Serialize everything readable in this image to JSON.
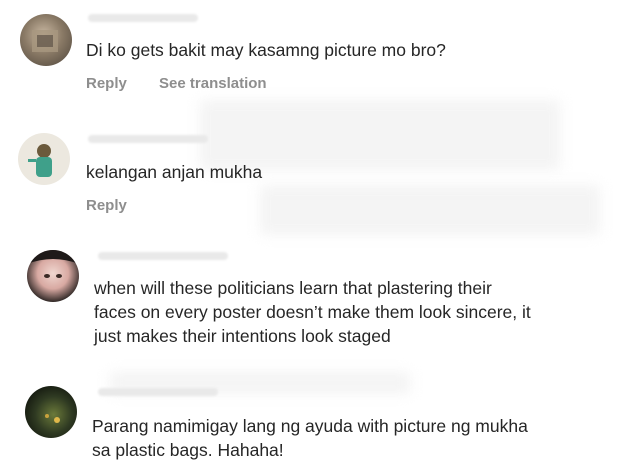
{
  "comments": [
    {
      "text": "Di ko gets bakit may kasamng picture mo bro?",
      "actions": [
        "Reply",
        "See translation"
      ]
    },
    {
      "text": "kelangan anjan mukha",
      "actions": [
        "Reply"
      ]
    },
    {
      "text": "when will these politicians learn that plastering their\nfaces on every poster doesn’t make them look sincere, it\njust makes their intentions look staged",
      "actions": []
    },
    {
      "text": "Parang namimigay lang ng ayuda with picture ng mukha\nsa plastic bags. Hahaha!",
      "actions": []
    }
  ],
  "colors": {
    "text": "#262626",
    "secondary": "#8e8e8e",
    "background": "#ffffff"
  },
  "icons": [
    "avatar-1",
    "avatar-2",
    "avatar-3",
    "avatar-4"
  ]
}
